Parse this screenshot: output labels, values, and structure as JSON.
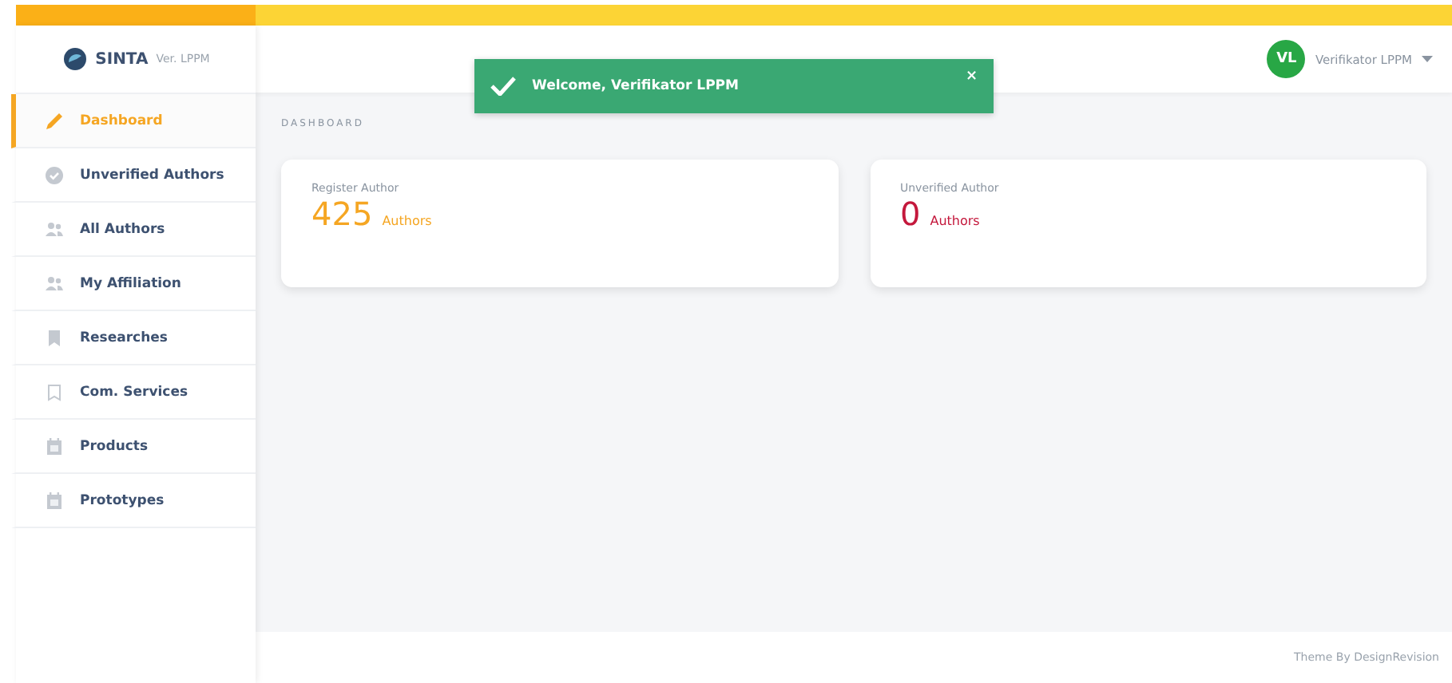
{
  "brand": {
    "name": "SINTA",
    "suffix": "Ver. LPPM"
  },
  "sidebar": {
    "items": [
      {
        "label": "Dashboard",
        "selected": true
      },
      {
        "label": "Unverified Authors",
        "selected": false
      },
      {
        "label": "All Authors",
        "selected": false
      },
      {
        "label": "My Affiliation",
        "selected": false
      },
      {
        "label": "Researches",
        "selected": false
      },
      {
        "label": "Com. Services",
        "selected": false
      },
      {
        "label": "Products",
        "selected": false
      },
      {
        "label": "Prototypes",
        "selected": false
      }
    ]
  },
  "user": {
    "initials": "VL",
    "name": "Verifikator LPPM"
  },
  "toast": {
    "message": "Welcome, Verifikator LPPM",
    "close": "×"
  },
  "page_title": "DASHBOARD",
  "cards": [
    {
      "title": "Register Author",
      "value": "425",
      "unit": "Authors",
      "color": "#f5a623"
    },
    {
      "title": "Unverified Author",
      "value": "0",
      "unit": "Authors",
      "color": "#c4183c"
    }
  ],
  "footer": "Theme By DesignRevision"
}
